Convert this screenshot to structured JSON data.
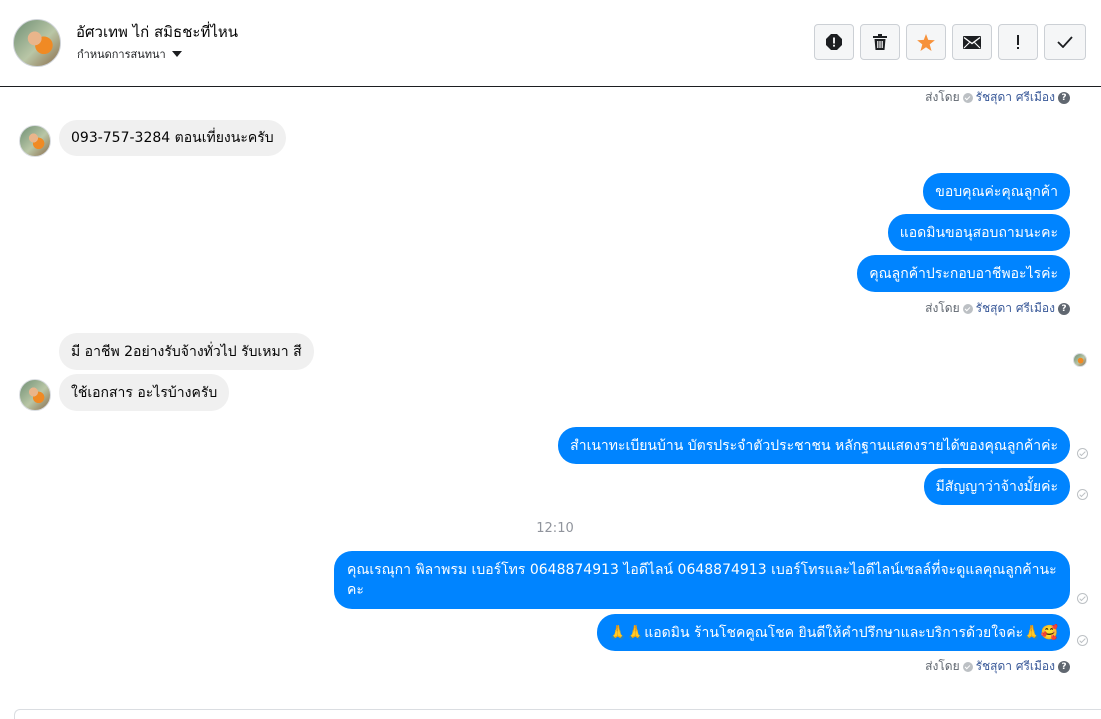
{
  "header": {
    "contact_name": "อัศวเทพ ไก่ สมิธชะที่ไหน",
    "subtitle": "กำหนดการสนทนา",
    "actions": [
      {
        "icon": "report-icon",
        "label": "report"
      },
      {
        "icon": "trash-icon",
        "label": "delete"
      },
      {
        "icon": "star-icon",
        "label": "star"
      },
      {
        "icon": "envelope-icon",
        "label": "mark unread"
      },
      {
        "icon": "exclamation-icon",
        "label": "spam"
      },
      {
        "icon": "checkmark-icon",
        "label": "done"
      }
    ]
  },
  "meta": {
    "sent_by": "ส่งโดย",
    "sender_name": "รัชสุดา ศรีเมือง"
  },
  "messages": {
    "m1": "093-757-3284  ตอนเที่ยงนะครับ",
    "m2": "ขอบคุณค่ะคุณลูกค้า",
    "m3": "แอดมินขอนุสอบถามนะคะ",
    "m4": "คุณลูกค้าประกอบอาชีพอะไรค่ะ",
    "m5": "มี อาชีพ 2อย่างรับจ้างทั่วไป รับเหมา สี",
    "m6": "ใช้เอกสาร อะไรบ้างครับ",
    "m7": "สำเนาทะเบียนบ้าน บัตรประจำตัวประชาชน หลักฐานแสดงรายได้ของคุณลูกค้าค่ะ",
    "m8": "มีสัญญาว่าจ้างมั้ยค่ะ",
    "timestamp": "12:10",
    "m9": "คุณเรณุกา พิลาพรม        เบอร์โทร 0648874913  ไอดีไลน์ 0648874913   เบอร์โทรและไอดีไลน์เซลล์ที่จะดูแลคุณลูกค้านะคะ",
    "m10": "🙏🙏แอดมิน ร้านโชคคูณโชค ยินดีให้คำปรึกษาและบริการด้วยใจค่ะ🙏🥰"
  },
  "colors": {
    "outgoing_bubble": "#0084ff",
    "incoming_bubble": "#f0f0f0",
    "star": "#f7923b"
  }
}
